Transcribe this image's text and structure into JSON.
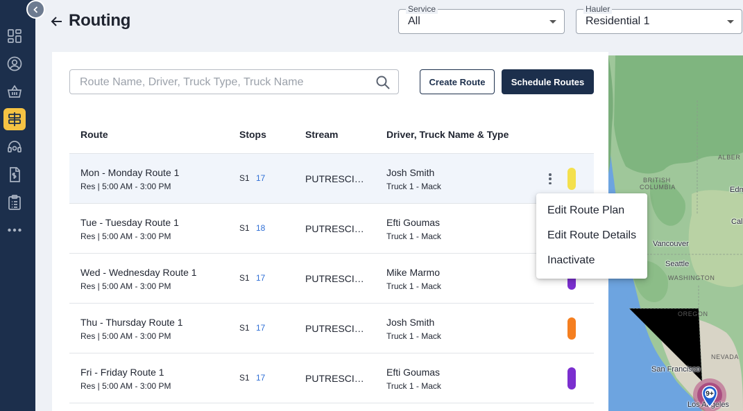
{
  "page": {
    "title": "Routing"
  },
  "filters": {
    "service": {
      "label": "Service",
      "value": "All"
    },
    "hauler": {
      "label": "Hauler",
      "value": "Residential 1"
    }
  },
  "search": {
    "placeholder": "Route Name, Driver, Truck Type, Truck Name"
  },
  "buttons": {
    "create": "Create Route",
    "schedule": "Schedule Routes"
  },
  "table": {
    "headers": [
      "Route",
      "Stops",
      "Stream",
      "Driver, Truck Name & Type"
    ],
    "rows": [
      {
        "name": "Mon - Monday Route 1",
        "sub": "Res | 5:00 AM - 3:00 PM",
        "stop_id": "S1",
        "stop_count": "17",
        "stream": "PUTRESCIBLE",
        "driver": "Josh Smith",
        "truck": "Truck 1 - Mack",
        "color": "#f4e04d"
      },
      {
        "name": "Tue - Tuesday Route 1",
        "sub": "Res | 5:00 AM - 3:00 PM",
        "stop_id": "S1",
        "stop_count": "18",
        "stream": "PUTRESCIBLE",
        "driver": "Efti Goumas",
        "truck": "Truck 1 - Mack",
        "color": "#2d7fd4"
      },
      {
        "name": "Wed - Wednesday Route 1",
        "sub": "Res | 5:00 AM - 3:00 PM",
        "stop_id": "S1",
        "stop_count": "17",
        "stream": "PUTRESCIBLE",
        "driver": "Mike Marmo",
        "truck": "Truck 1 - Mack",
        "color": "#7b2fcf"
      },
      {
        "name": "Thu - Thursday Route 1",
        "sub": "Res | 5:00 AM - 3:00 PM",
        "stop_id": "S1",
        "stop_count": "17",
        "stream": "PUTRESCIBLE",
        "driver": "Josh Smith",
        "truck": "Truck 1 - Mack",
        "color": "#f57f20"
      },
      {
        "name": "Fri - Friday Route 1",
        "sub": "Res | 5:00 AM - 3:00 PM",
        "stop_id": "S1",
        "stop_count": "17",
        "stream": "PUTRESCIBLE",
        "driver": "Efti Goumas",
        "truck": "Truck 1 - Mack",
        "color": "#7b2fcf"
      }
    ]
  },
  "context_menu": {
    "items": [
      "Edit Route Plan",
      "Edit Route Details",
      "Inactivate"
    ]
  },
  "map": {
    "labels": {
      "bc1": "BRITISH",
      "bc2": "COLUMBIA",
      "alberta": "ALBER",
      "edm": "Edm",
      "cal": "Cal",
      "vancouver": "Vancouver",
      "seattle": "Seattle",
      "washington": "WASHINGTON",
      "oregon": "OREGON",
      "nevada": "NEVADA",
      "sf": "San Francisco",
      "la": "Los Angeles"
    },
    "cluster_count": "9+"
  },
  "sidebar": {
    "icons": [
      "dashboard-icon",
      "customer-icon",
      "basket-icon",
      "routing-icon",
      "support-icon",
      "billing-icon",
      "clipboard-icon",
      "more-icon"
    ]
  }
}
